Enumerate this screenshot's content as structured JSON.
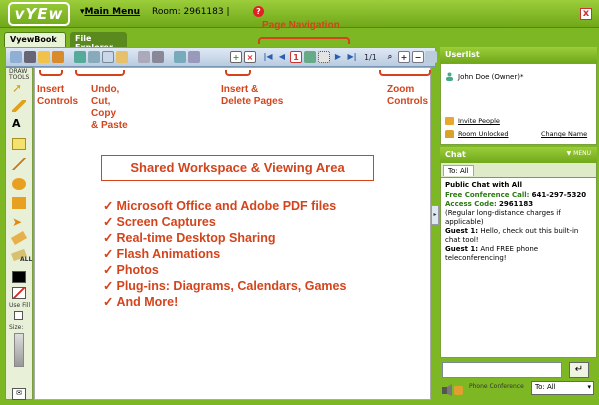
{
  "header": {
    "logo": "vYEw",
    "main_menu": "Main Menu",
    "room_label": "Room: 2961183 |",
    "help": "?",
    "close": "x"
  },
  "tabs": [
    {
      "label": "VyewBook"
    },
    {
      "label": "File Explorer"
    }
  ],
  "toolbar": {
    "page_counter": "1/1"
  },
  "annotations": {
    "page_navigation": "Page Navigation",
    "insert_controls": "Insert\nControls",
    "undo": "Undo,\nCut,\nCopy\n& Paste",
    "insert_delete": "Insert &\nDelete Pages",
    "zoom": "Zoom\nControls",
    "workspace": "Shared Workspace & Viewing Area"
  },
  "features": [
    "Microsoft Office and Adobe PDF files",
    "Screen Captures",
    "Real-time Desktop Sharing",
    "Flash Animations",
    "Photos",
    "Plug-ins: Diagrams, Calendars, Games",
    "And More!"
  ],
  "lefttools": {
    "draw_label": "DRAW TOOLS",
    "all_label": "ALL",
    "use_fill": "Use Fill",
    "size": "Size:"
  },
  "userlist": {
    "title": "Userlist",
    "user": "John Doe (Owner)*",
    "invite": "Invite People",
    "room_status": "Room Unlocked",
    "change_name": "Change Name"
  },
  "chat": {
    "title": "Chat",
    "menu": "▼ MENU",
    "tab": "To: All",
    "heading": "Public Chat with All",
    "conf_call_label": "Free Conference Call:",
    "conf_call_number": "641-297-5320",
    "access_label": "Access Code:",
    "access_code": "2961183",
    "note": "(Regular long-distance charges if applicable)",
    "guest_label": "Guest 1:",
    "msg1": "Hello, check out this built-in chat tool!",
    "msg2": "And FREE phone teleconferencing!",
    "send": "↵",
    "phone_label": "Phone Conference",
    "to_select": "To: All"
  },
  "colors": {
    "accent_green": "#7db824",
    "annotation_red": "#d4441c"
  }
}
